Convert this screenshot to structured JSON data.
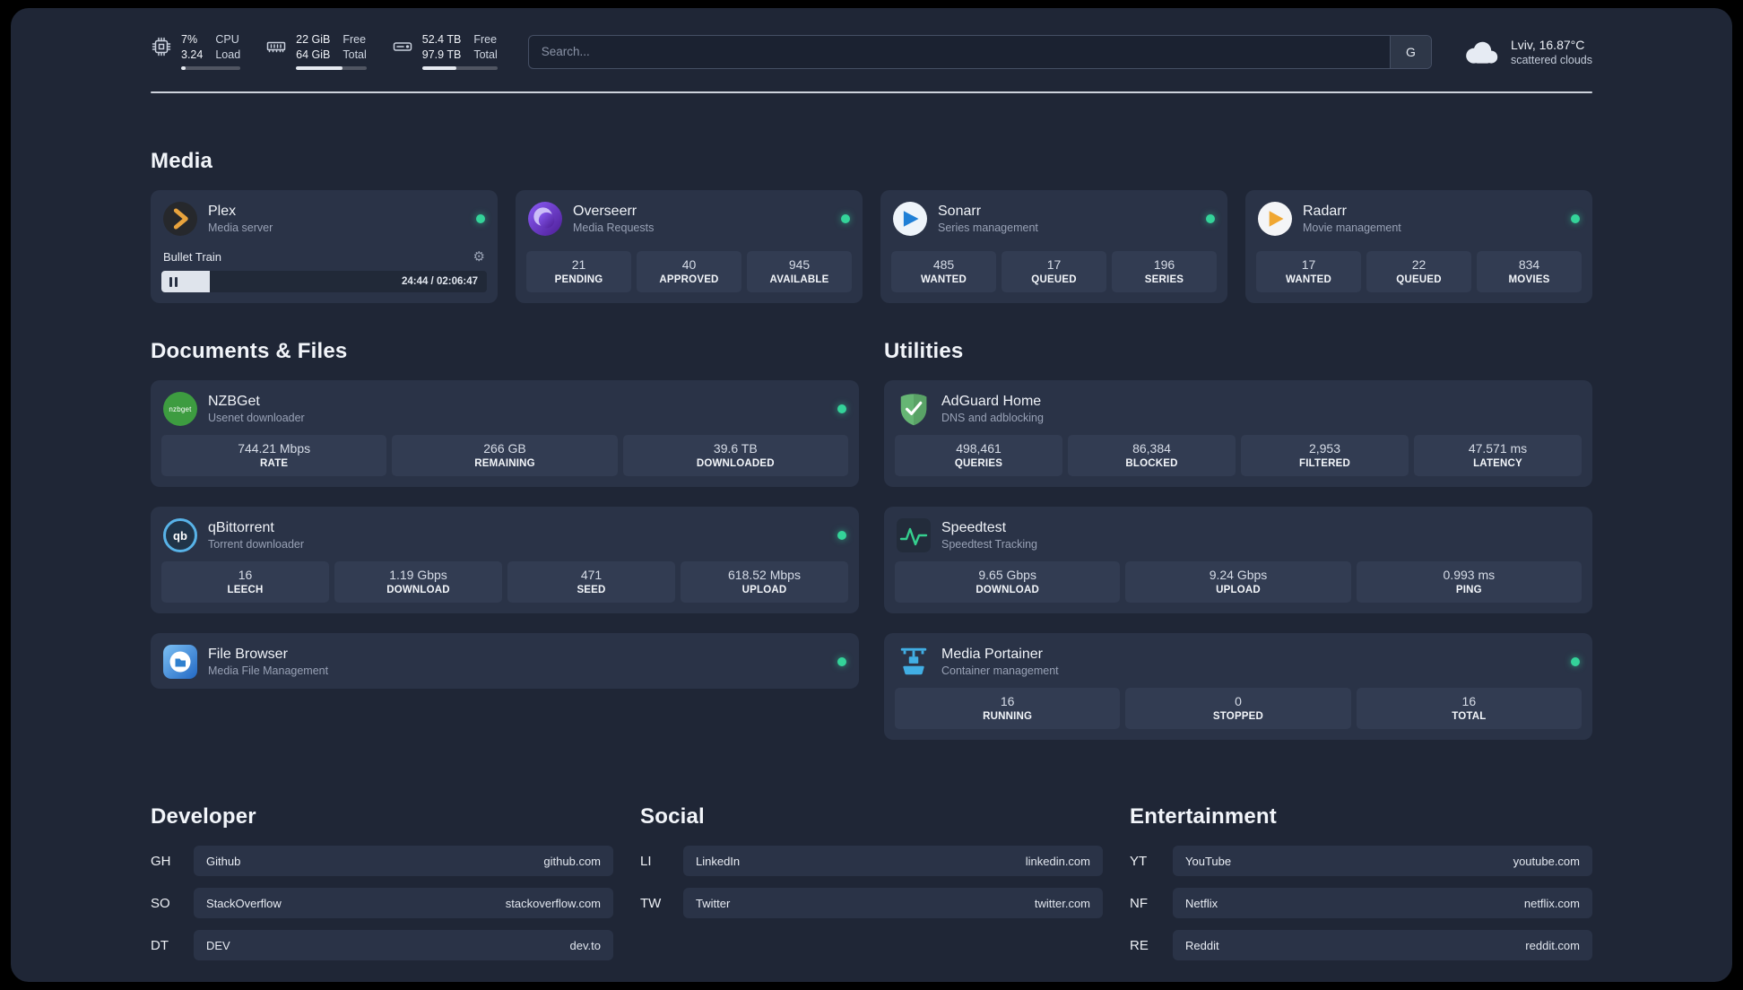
{
  "topbar": {
    "cpu": {
      "value1": "7%",
      "value2": "3.24",
      "label1": "CPU",
      "label2": "Load",
      "percent": 7
    },
    "memory": {
      "value1": "22 GiB",
      "value2": "64 GiB",
      "label1": "Free",
      "label2": "Total",
      "percent": 66
    },
    "disk": {
      "value1": "52.4 TB",
      "value2": "97.9 TB",
      "label1": "Free",
      "label2": "Total",
      "percent": 46
    },
    "search": {
      "placeholder": "Search...",
      "button_label": "G"
    },
    "weather": {
      "location": "Lviv, 16.87°C",
      "condition": "scattered clouds"
    }
  },
  "media": {
    "title": "Media",
    "plex": {
      "name": "Plex",
      "subtitle": "Media server",
      "now_playing": "Bullet Train",
      "time": "24:44 / 02:06:47",
      "progress": 15
    },
    "overseerr": {
      "name": "Overseerr",
      "subtitle": "Media Requests",
      "stats": [
        {
          "value": "21",
          "label": "PENDING"
        },
        {
          "value": "40",
          "label": "APPROVED"
        },
        {
          "value": "945",
          "label": "AVAILABLE"
        }
      ]
    },
    "sonarr": {
      "name": "Sonarr",
      "subtitle": "Series management",
      "stats": [
        {
          "value": "485",
          "label": "WANTED"
        },
        {
          "value": "17",
          "label": "QUEUED"
        },
        {
          "value": "196",
          "label": "SERIES"
        }
      ]
    },
    "radarr": {
      "name": "Radarr",
      "subtitle": "Movie management",
      "stats": [
        {
          "value": "17",
          "label": "WANTED"
        },
        {
          "value": "22",
          "label": "QUEUED"
        },
        {
          "value": "834",
          "label": "MOVIES"
        }
      ]
    }
  },
  "documents": {
    "title": "Documents & Files",
    "nzbget": {
      "name": "NZBGet",
      "subtitle": "Usenet downloader",
      "stats": [
        {
          "value": "744.21 Mbps",
          "label": "RATE"
        },
        {
          "value": "266 GB",
          "label": "REMAINING"
        },
        {
          "value": "39.6 TB",
          "label": "DOWNLOADED"
        }
      ]
    },
    "qbittorrent": {
      "name": "qBittorrent",
      "subtitle": "Torrent downloader",
      "stats": [
        {
          "value": "16",
          "label": "LEECH"
        },
        {
          "value": "1.19 Gbps",
          "label": "DOWNLOAD"
        },
        {
          "value": "471",
          "label": "SEED"
        },
        {
          "value": "618.52 Mbps",
          "label": "UPLOAD"
        }
      ]
    },
    "filebrowser": {
      "name": "File Browser",
      "subtitle": "Media File Management"
    }
  },
  "utilities": {
    "title": "Utilities",
    "adguard": {
      "name": "AdGuard Home",
      "subtitle": "DNS and adblocking",
      "stats": [
        {
          "value": "498,461",
          "label": "QUERIES"
        },
        {
          "value": "86,384",
          "label": "BLOCKED"
        },
        {
          "value": "2,953",
          "label": "FILTERED"
        },
        {
          "value": "47.571 ms",
          "label": "LATENCY"
        }
      ]
    },
    "speedtest": {
      "name": "Speedtest",
      "subtitle": "Speedtest Tracking",
      "stats": [
        {
          "value": "9.65 Gbps",
          "label": "DOWNLOAD"
        },
        {
          "value": "9.24 Gbps",
          "label": "UPLOAD"
        },
        {
          "value": "0.993 ms",
          "label": "PING"
        }
      ]
    },
    "portainer": {
      "name": "Media Portainer",
      "subtitle": "Container management",
      "stats": [
        {
          "value": "16",
          "label": "RUNNING"
        },
        {
          "value": "0",
          "label": "STOPPED"
        },
        {
          "value": "16",
          "label": "TOTAL"
        }
      ]
    }
  },
  "bookmarks": {
    "developer": {
      "title": "Developer",
      "links": [
        {
          "code": "GH",
          "name": "Github",
          "domain": "github.com"
        },
        {
          "code": "SO",
          "name": "StackOverflow",
          "domain": "stackoverflow.com"
        },
        {
          "code": "DT",
          "name": "DEV",
          "domain": "dev.to"
        }
      ]
    },
    "social": {
      "title": "Social",
      "links": [
        {
          "code": "LI",
          "name": "LinkedIn",
          "domain": "linkedin.com"
        },
        {
          "code": "TW",
          "name": "Twitter",
          "domain": "twitter.com"
        }
      ]
    },
    "entertainment": {
      "title": "Entertainment",
      "links": [
        {
          "code": "YT",
          "name": "YouTube",
          "domain": "youtube.com"
        },
        {
          "code": "NF",
          "name": "Netflix",
          "domain": "netflix.com"
        },
        {
          "code": "RE",
          "name": "Reddit",
          "domain": "reddit.com"
        }
      ]
    }
  },
  "icons": {
    "gear": "⚙",
    "nzbget_text": "nzbget",
    "qbittorrent_text": "qb"
  },
  "colors": {
    "bg": "#1f2636",
    "card": "#2a3347",
    "tile": "#323c52",
    "status_green": "#34d399",
    "divider": "#dde2ec"
  }
}
